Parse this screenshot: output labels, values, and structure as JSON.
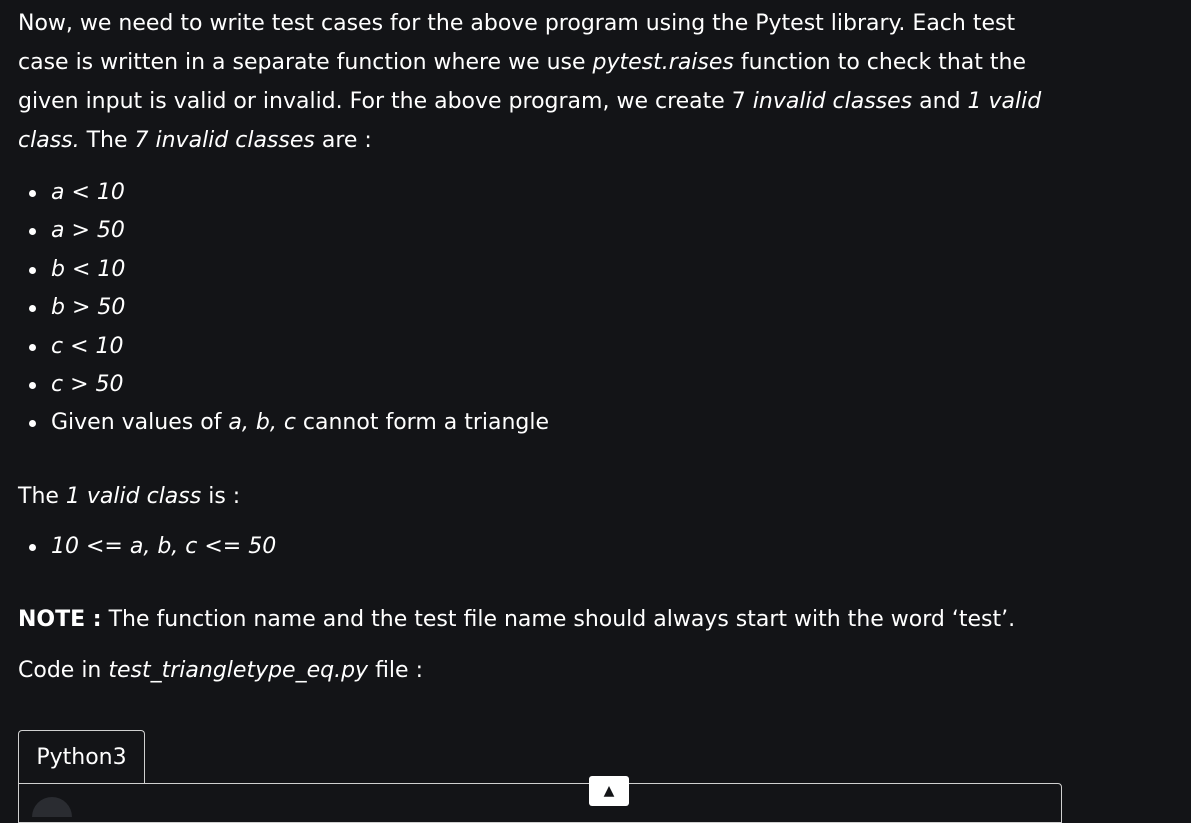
{
  "intro": {
    "t1": "Now, we need to write test cases for the above program using the Pytest library. Each test case is written in a separate function where we use ",
    "func": "pytest.raises",
    "t2": " function to check that the given input is valid or invalid. For the above program, we create 7 ",
    "invalid": "invalid classes",
    "t3": " and ",
    "one_valid": "1 valid class.",
    "t4": " The ",
    "seven_invalid": "7 invalid classes",
    "t5": " are :"
  },
  "invalid_classes": [
    "a < 10",
    "a > 50",
    "b < 10",
    "b > 50",
    "c < 10",
    "c > 50"
  ],
  "triangle_item": {
    "prefix": "Given values of ",
    "vars": "a, b, c",
    "suffix": " cannot form a triangle"
  },
  "valid_heading": {
    "prefix": "The ",
    "term": "1 valid class",
    "suffix": " is :"
  },
  "valid_classes": [
    "10 <= a, b, c <= 50"
  ],
  "note": {
    "label": "NOTE :",
    "text": " The function name and the test file name should always start with the word ‘test’."
  },
  "code_line": {
    "prefix": "Code in ",
    "file": "test_triangletype_eq.py",
    "suffix": " file :"
  },
  "code_tab": {
    "label": "Python3"
  },
  "run_button": {
    "icon": "▲"
  }
}
